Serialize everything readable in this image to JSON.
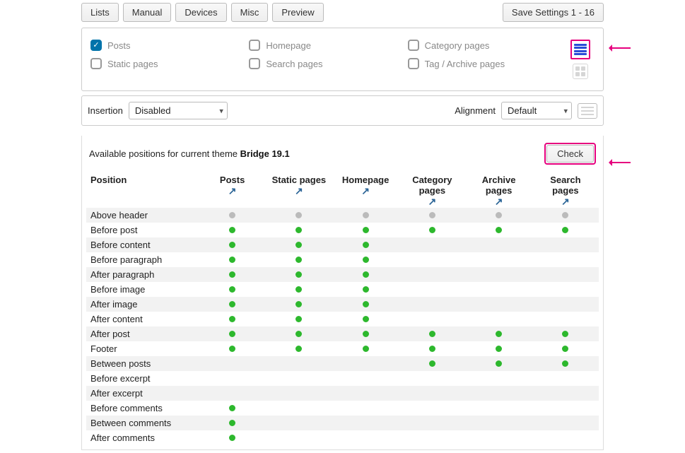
{
  "topbar": {
    "buttons": [
      "Lists",
      "Manual",
      "Devices",
      "Misc",
      "Preview"
    ],
    "save_label": "Save Settings 1 - 16"
  },
  "checks": {
    "col1": [
      {
        "label": "Posts",
        "checked": true
      },
      {
        "label": "Static pages",
        "checked": false
      }
    ],
    "col2": [
      {
        "label": "Homepage",
        "checked": false
      },
      {
        "label": "Search pages",
        "checked": false
      }
    ],
    "col3": [
      {
        "label": "Category pages",
        "checked": false
      },
      {
        "label": "Tag / Archive pages",
        "checked": false
      }
    ]
  },
  "insertion": {
    "label": "Insertion",
    "value": "Disabled"
  },
  "alignment": {
    "label": "Alignment",
    "value": "Default"
  },
  "available": {
    "text_prefix": "Available positions for current theme ",
    "theme": "Bridge 19.1",
    "check_label": "Check"
  },
  "columns": [
    "Position",
    "Posts",
    "Static pages",
    "Homepage",
    "Category pages",
    "Archive pages",
    "Search pages"
  ],
  "rows": [
    {
      "pos": "Above header",
      "v": [
        "grey",
        "grey",
        "grey",
        "grey",
        "grey",
        "grey"
      ]
    },
    {
      "pos": "Before post",
      "v": [
        "green",
        "green",
        "green",
        "green",
        "green",
        "green"
      ]
    },
    {
      "pos": "Before content",
      "v": [
        "green",
        "green",
        "green",
        "",
        "",
        ""
      ]
    },
    {
      "pos": "Before paragraph",
      "v": [
        "green",
        "green",
        "green",
        "",
        "",
        ""
      ]
    },
    {
      "pos": "After paragraph",
      "v": [
        "green",
        "green",
        "green",
        "",
        "",
        ""
      ]
    },
    {
      "pos": "Before image",
      "v": [
        "green",
        "green",
        "green",
        "",
        "",
        ""
      ]
    },
    {
      "pos": "After image",
      "v": [
        "green",
        "green",
        "green",
        "",
        "",
        ""
      ]
    },
    {
      "pos": "After content",
      "v": [
        "green",
        "green",
        "green",
        "",
        "",
        ""
      ]
    },
    {
      "pos": "After post",
      "v": [
        "green",
        "green",
        "green",
        "green",
        "green",
        "green"
      ]
    },
    {
      "pos": "Footer",
      "v": [
        "green",
        "green",
        "green",
        "green",
        "green",
        "green"
      ]
    },
    {
      "pos": "Between posts",
      "v": [
        "",
        "",
        "",
        "green",
        "green",
        "green"
      ]
    },
    {
      "pos": "Before excerpt",
      "v": [
        "",
        "",
        "",
        "",
        "",
        ""
      ]
    },
    {
      "pos": "After excerpt",
      "v": [
        "",
        "",
        "",
        "",
        "",
        ""
      ]
    },
    {
      "pos": "Before comments",
      "v": [
        "green",
        "",
        "",
        "",
        "",
        ""
      ]
    },
    {
      "pos": "Between comments",
      "v": [
        "green",
        "",
        "",
        "",
        "",
        ""
      ]
    },
    {
      "pos": "After comments",
      "v": [
        "green",
        "",
        "",
        "",
        "",
        ""
      ]
    }
  ]
}
